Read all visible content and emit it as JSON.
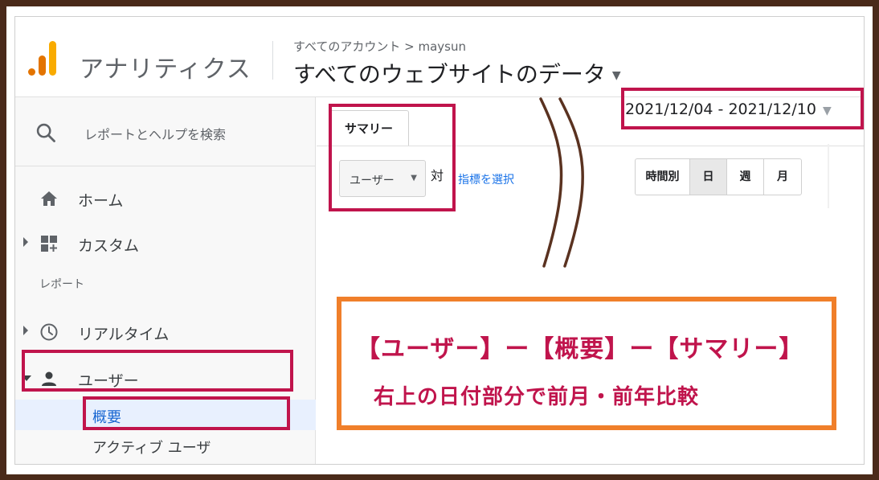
{
  "header": {
    "app_title": "アナリティクス",
    "breadcrumb": "すべてのアカウント > maysun",
    "property_name": "すべてのウェブサイトのデータ"
  },
  "sidebar": {
    "search_placeholder": "レポートとヘルプを検索",
    "items": [
      {
        "label": "ホーム",
        "icon": "home-icon"
      },
      {
        "label": "カスタム",
        "icon": "dashboard-icon"
      }
    ],
    "section_label": "レポート",
    "report_items": [
      {
        "label": "リアルタイム",
        "icon": "clock-icon"
      },
      {
        "label": "ユーザー",
        "icon": "person-icon"
      }
    ],
    "sub_items": [
      {
        "label": "概要"
      },
      {
        "label": "アクティブ ユーザ"
      }
    ]
  },
  "main": {
    "date_range": "2021/12/04 - 2021/12/10",
    "tab_label": "サマリー",
    "metric_select": "ユーザー",
    "vs_label": "対",
    "select_metric_link": "指標を選択",
    "granularity": [
      "時間別",
      "日",
      "週",
      "月"
    ],
    "granularity_selected": "日"
  },
  "annotation": {
    "line1": "【ユーザー】ー【概要】ー【サマリー】",
    "line2": "右上の日付部分で前月・前年比較"
  },
  "colors": {
    "highlight": "#c0144c",
    "callout_border": "#f07f2a",
    "frame": "#4a2a1a",
    "logo_orange": "#f9ab00",
    "logo_dark": "#e37400"
  }
}
